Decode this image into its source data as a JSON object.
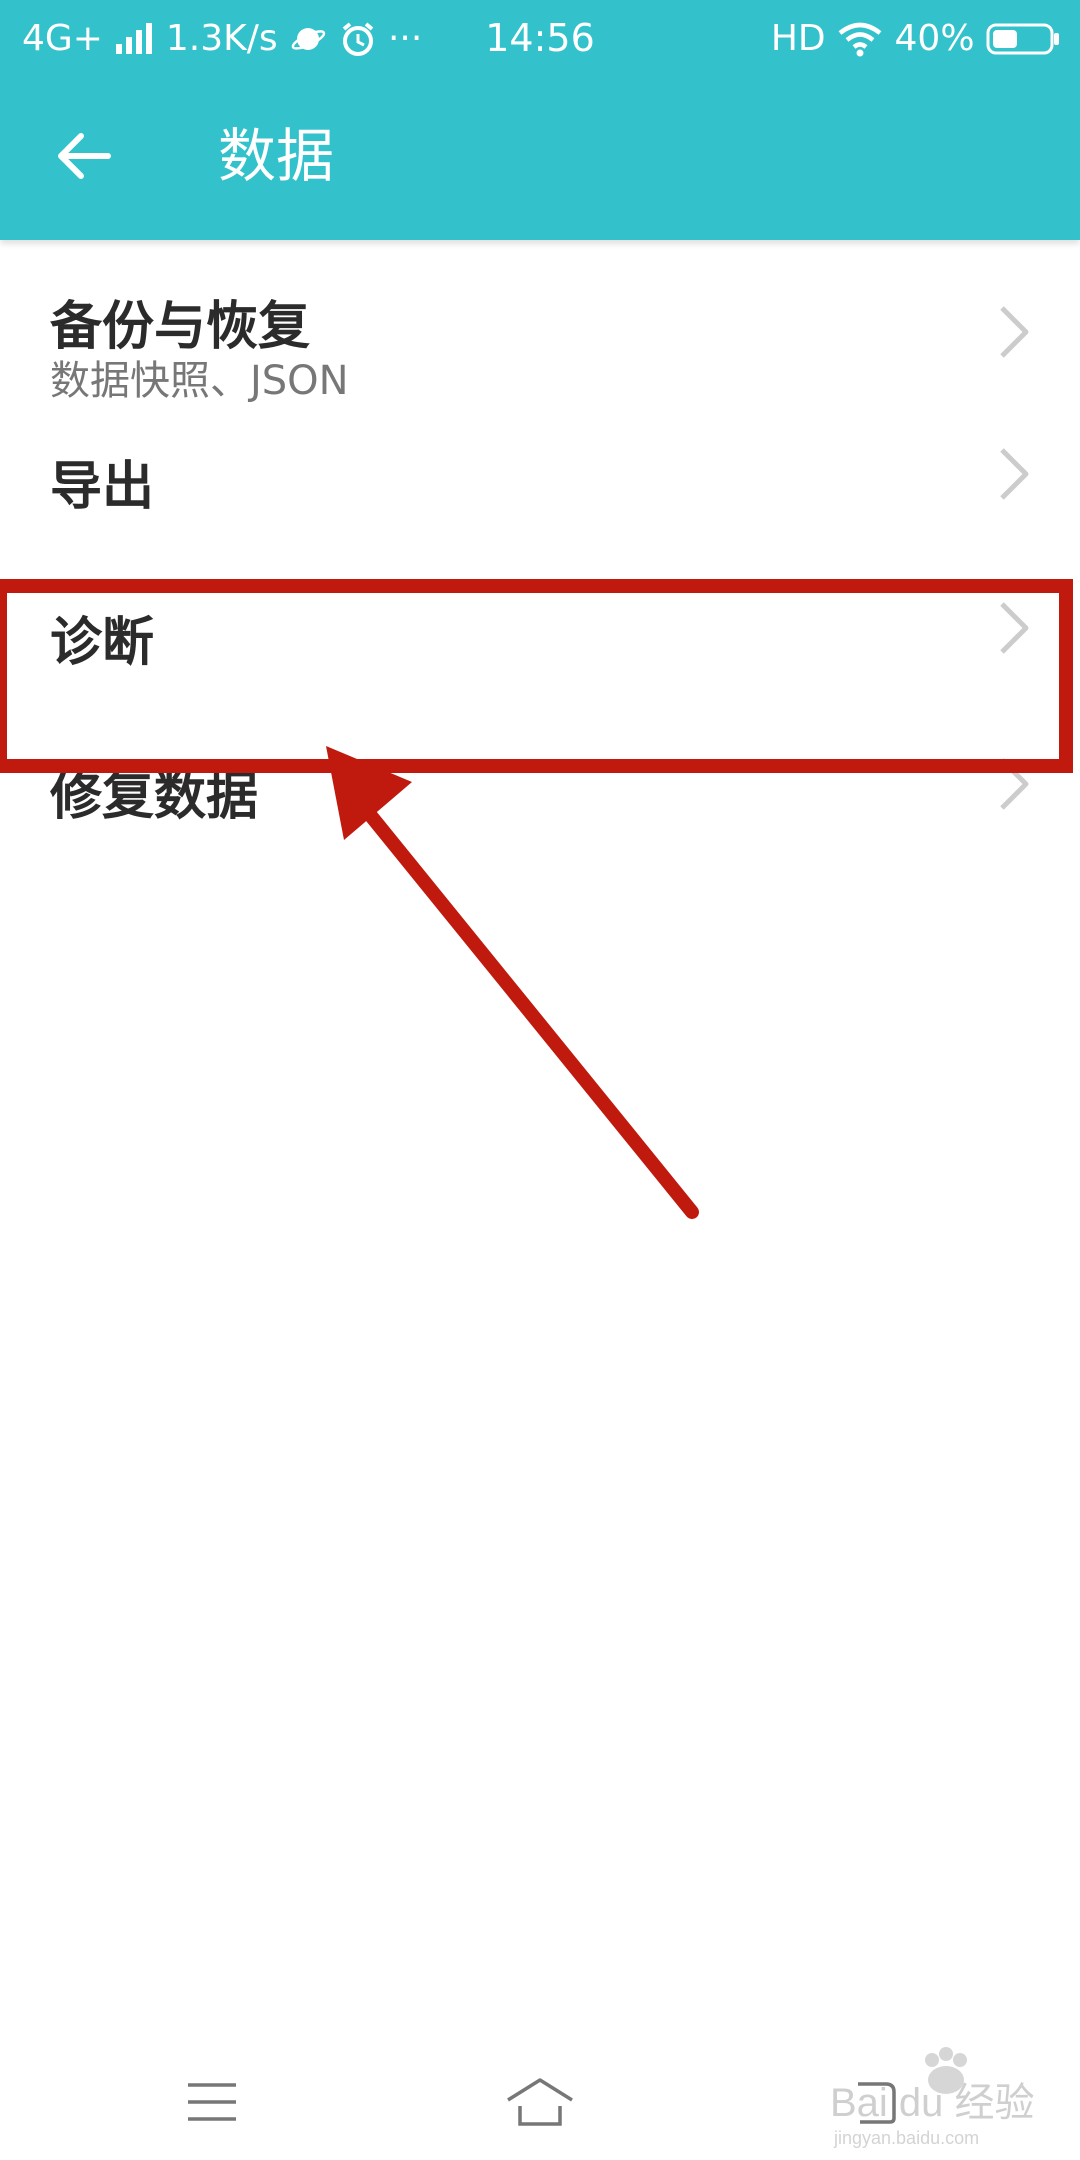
{
  "status_bar": {
    "network": "4G+",
    "speed": "1.3K/s",
    "dots": "···",
    "time": "14:56",
    "hd": "HD",
    "battery": "40%"
  },
  "header": {
    "title": "数据",
    "back_icon": "arrow-left-icon"
  },
  "list": {
    "items": [
      {
        "title": "备份与恢复",
        "subtitle": "数据快照、JSON"
      },
      {
        "title": "导出"
      },
      {
        "title": "诊断"
      },
      {
        "title": "修复数据"
      }
    ]
  },
  "annotation": {
    "highlight_color": "#c0190e",
    "highlighted_item": "诊断"
  },
  "nav_bar": {
    "icons": [
      "menu-icon",
      "home-icon",
      "back-icon"
    ]
  },
  "watermark": {
    "brand": "Bai du 经验",
    "url": "jingyan.baidu.com"
  },
  "colors": {
    "header_bg": "#33c2cb",
    "title_text": "#2b2b2b",
    "subtitle_text": "#777777",
    "chevron": "#cccccc"
  }
}
